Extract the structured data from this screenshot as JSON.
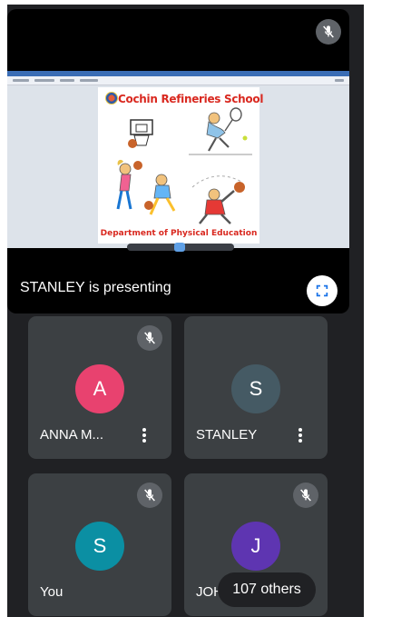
{
  "presentation": {
    "status_label": "STANLEY is presenting",
    "slide": {
      "title": "Cochin Refineries School",
      "footer": "Department of Physical Education"
    }
  },
  "participants": [
    {
      "name": "ANNA M...",
      "initial": "A",
      "avatar_color": "#e8426f",
      "muted": true,
      "has_menu": true
    },
    {
      "name": "STANLEY",
      "initial": "S",
      "avatar_color": "#455a64",
      "muted": false,
      "has_menu": true
    },
    {
      "name": "You",
      "initial": "S",
      "avatar_color": "#0b8fa3",
      "muted": true,
      "has_menu": false
    },
    {
      "name": "JOH",
      "initial": "J",
      "avatar_color": "#5e35b1",
      "muted": true,
      "has_menu": false
    }
  ],
  "others_label": "107 others",
  "colors": {
    "background": "#202124",
    "tile": "#3c4043",
    "mic_badge": "#5f6368"
  }
}
